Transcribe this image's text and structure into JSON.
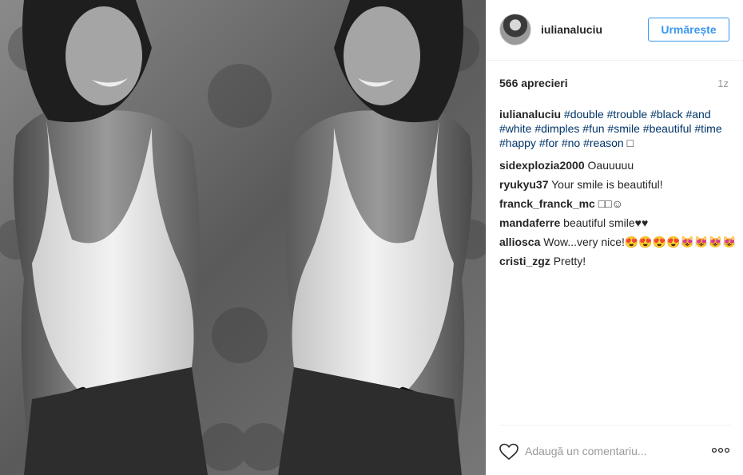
{
  "header": {
    "username": "iulianaluciu",
    "follow_label": "Urmărește"
  },
  "stats": {
    "likes": "566 aprecieri",
    "time": "1z"
  },
  "caption": {
    "username": "iulianaluciu",
    "hashtags": [
      "#double",
      "#trouble",
      "#black",
      "#and",
      "#white",
      "#dimples",
      "#fun",
      "#smile",
      "#beautiful",
      "#time",
      "#happy",
      "#for",
      "#no",
      "#reason"
    ],
    "trailing": "□"
  },
  "comments": [
    {
      "user": "sidexplozia2000",
      "text": "Oauuuuu"
    },
    {
      "user": "ryukyu37",
      "text": "Your smile is beautiful!"
    },
    {
      "user": "franck_franck_mc",
      "text": "□□☺"
    },
    {
      "user": "mandaferre",
      "text": "beautiful smile♥♥"
    },
    {
      "user": "alliosca",
      "text": "Wow...very nice!😍😍😍😍😻😻😻😻"
    },
    {
      "user": "cristi_zgz",
      "text": "Pretty!"
    }
  ],
  "footer": {
    "comment_placeholder": "Adaugă un comentariu...",
    "icons": [
      "heart-icon",
      "more-options-icon"
    ]
  },
  "colors": {
    "accent": "#3897f0",
    "hashtag": "#003569",
    "muted": "#999999",
    "text": "#262626"
  }
}
